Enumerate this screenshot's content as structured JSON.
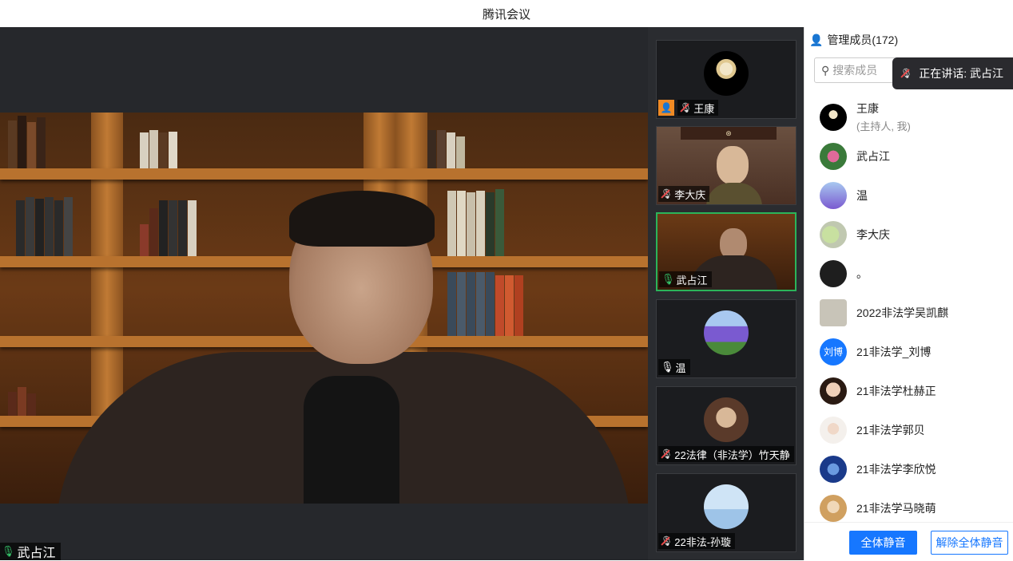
{
  "window": {
    "title": "腾讯会议"
  },
  "main_video": {
    "speaker_name": "武占江"
  },
  "thumbnails": [
    {
      "name": "王康",
      "muted": true,
      "host": true
    },
    {
      "name": "李大庆",
      "muted": true
    },
    {
      "name": "武占江",
      "muted": false,
      "active": true
    },
    {
      "name": "温",
      "muted": false
    },
    {
      "name": "22法律（非法学）竹天静",
      "muted": true
    },
    {
      "name": "22非法-孙璇",
      "muted": true
    }
  ],
  "panel": {
    "title": "管理成员(172)",
    "search_placeholder": "搜索成员",
    "speaking_label": "正在讲话: 武占江",
    "members": [
      {
        "name": "王康",
        "sub": "(主持人, 我)"
      },
      {
        "name": "武占江"
      },
      {
        "name": "温"
      },
      {
        "name": "李大庆"
      },
      {
        "name": "。"
      },
      {
        "name": "2022非法学吴凯麒"
      },
      {
        "name": "21非法学_刘博",
        "avatar_text": "刘博"
      },
      {
        "name": "21非法学杜赫正"
      },
      {
        "name": "21非法学郭贝"
      },
      {
        "name": "21非法学李欣悦"
      },
      {
        "name": "21非法学马晓萌"
      }
    ],
    "mute_all_label": "全体静音",
    "unmute_all_label": "解除全体静音"
  },
  "colors": {
    "accent": "#1677ff",
    "active_border": "#2bb45a",
    "host_badge": "#f08a24"
  }
}
